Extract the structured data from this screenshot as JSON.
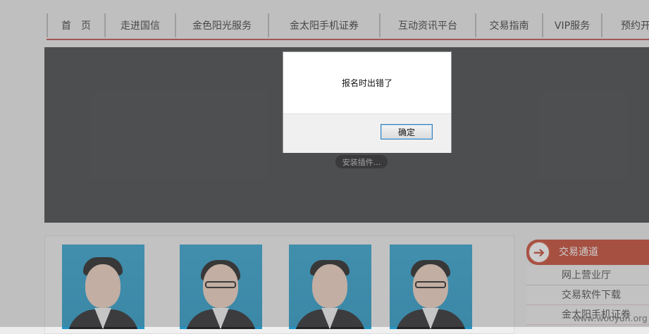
{
  "nav": {
    "items": [
      "首　页",
      "走进国信",
      "金色阳光服务",
      "金太阳手机证券",
      "互动资讯平台",
      "交易指南",
      "VIP服务",
      "预约开"
    ]
  },
  "player": {
    "plugin_label": "安装插件..."
  },
  "sidebar": {
    "title": "交易通道",
    "links": [
      "网上营业厅",
      "交易软件下载",
      "金太阳手机证券"
    ]
  },
  "dialog": {
    "message": "报名时出错了",
    "ok_label": "确定"
  },
  "watermark": "www.wooyun.org",
  "colors": {
    "accent": "#c5412c",
    "nav_rule": "#c14a4a",
    "player_bg": "#3d3e40"
  }
}
